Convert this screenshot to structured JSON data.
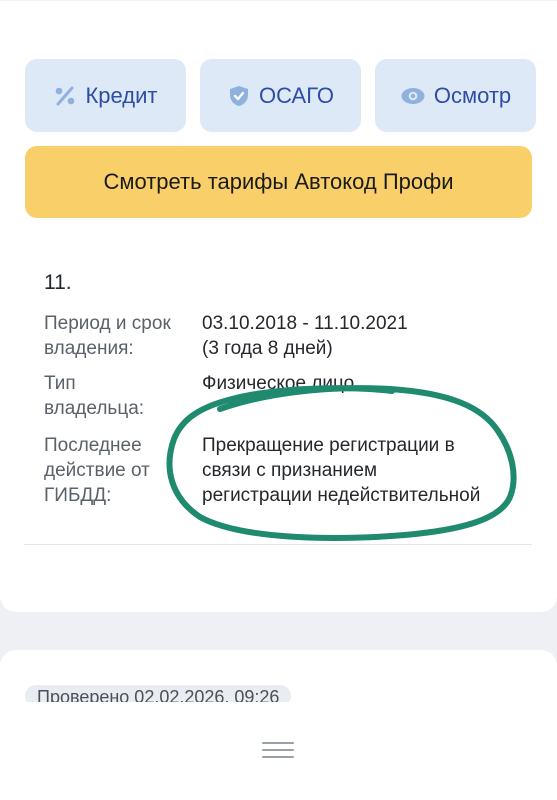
{
  "buttons": [
    {
      "label": "Кредит",
      "icon": "percent-icon"
    },
    {
      "label": "ОСАГО",
      "icon": "shield-check-icon"
    },
    {
      "label": "Осмотр",
      "icon": "eye-icon"
    }
  ],
  "cta_label": "Смотреть тарифы Автокод Профи",
  "record": {
    "number": "11.",
    "period_label_1": "Период и срок",
    "period_label_2": "владения:",
    "period_value_1": "03.10.2018 - 11.10.2021",
    "period_value_2": "(3 года 8 дней)",
    "type_label_1": "Тип",
    "type_label_2": "владельца:",
    "type_value": "Физическое лицо",
    "action_label_1": "Последнее",
    "action_label_2": "действие от",
    "action_label_3": "ГИБДД:",
    "action_value_1": "Прекращение регистрации в",
    "action_value_2": "связи с признанием",
    "action_value_3": "регистрации недействительной"
  },
  "next_card_chip": "Проверено 02.02.2026, 09:26",
  "colors": {
    "pill_bg": "#dde9f7",
    "pill_text": "#2f4ea3",
    "cta_bg": "#f9cf6a",
    "annotation_stroke": "#1f8a6e"
  }
}
